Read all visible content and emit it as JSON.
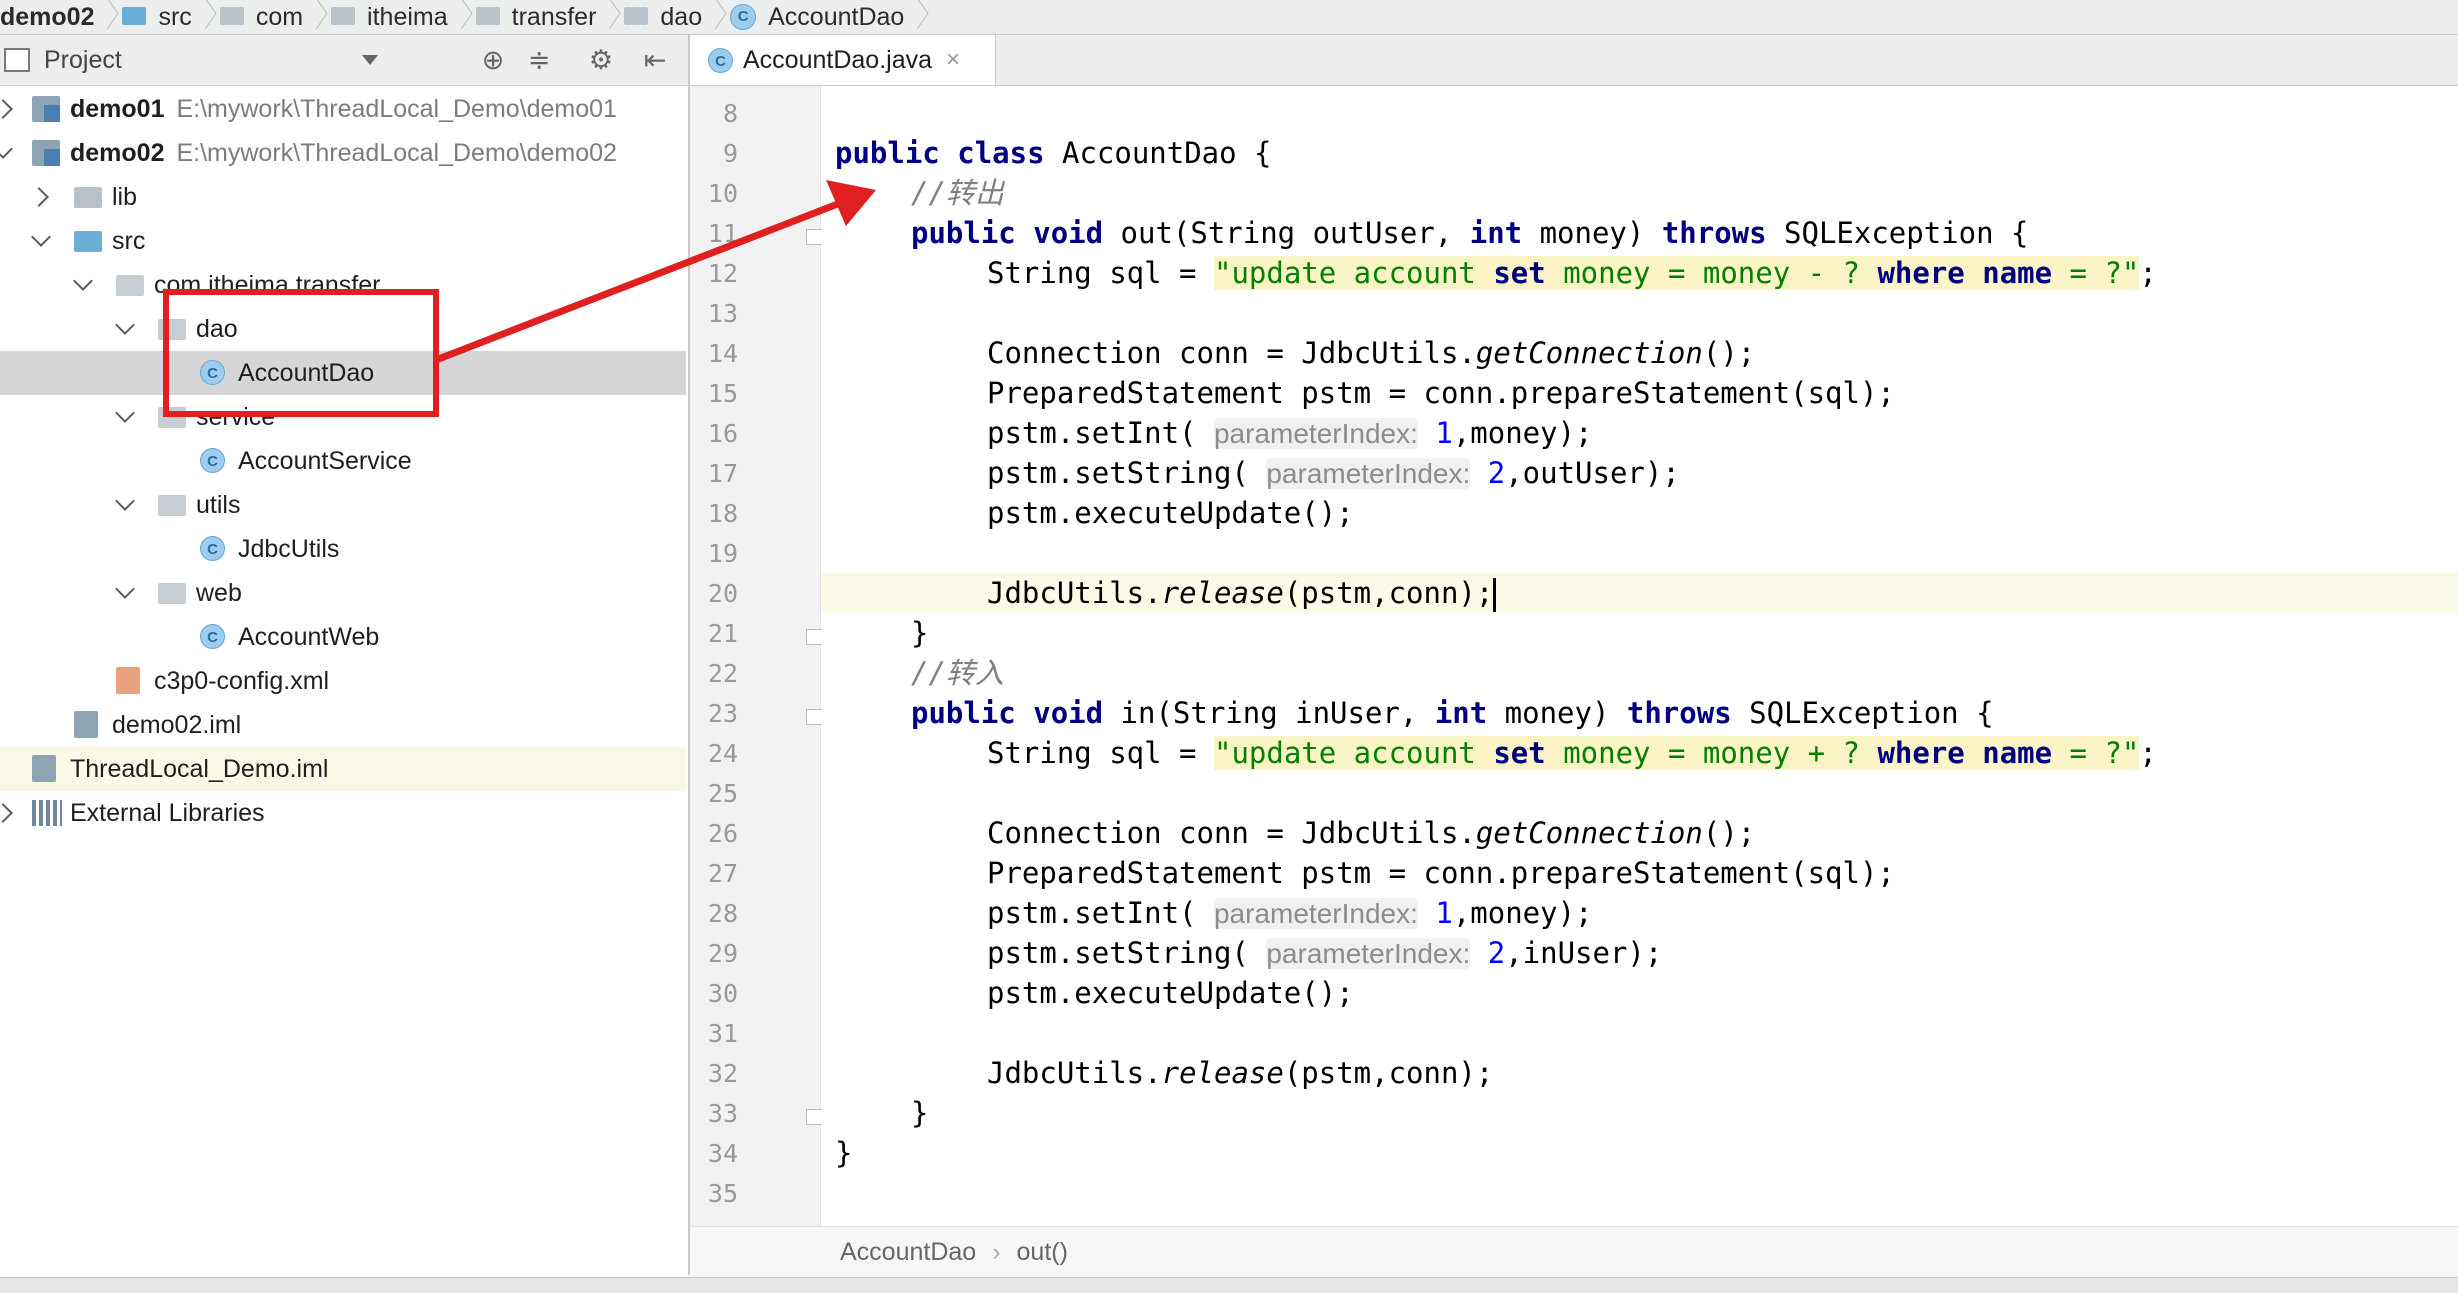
{
  "breadcrumbs": [
    "demo02",
    "src",
    "com",
    "itheima",
    "transfer",
    "dao",
    "AccountDao"
  ],
  "project_panel": {
    "title": "Project",
    "tree": [
      {
        "label": "demo01",
        "path": "E:\\mywork\\ThreadLocal_Demo\\demo01"
      },
      {
        "label": "demo02",
        "path": "E:\\mywork\\ThreadLocal_Demo\\demo02"
      },
      {
        "label": "lib"
      },
      {
        "label": "src"
      },
      {
        "label": "com.itheima.transfer"
      },
      {
        "label": "dao"
      },
      {
        "label": "AccountDao"
      },
      {
        "label": "service"
      },
      {
        "label": "AccountService"
      },
      {
        "label": "utils"
      },
      {
        "label": "JdbcUtils"
      },
      {
        "label": "web"
      },
      {
        "label": "AccountWeb"
      },
      {
        "label": "c3p0-config.xml"
      },
      {
        "label": "demo02.iml"
      },
      {
        "label": "ThreadLocal_Demo.iml"
      },
      {
        "label": "External Libraries"
      }
    ]
  },
  "editor": {
    "tab_label": "AccountDao.java",
    "tab_close": "×",
    "line_numbers": [
      "8",
      "9",
      "10",
      "11",
      "12",
      "13",
      "14",
      "15",
      "16",
      "17",
      "18",
      "19",
      "20",
      "21",
      "22",
      "23",
      "24",
      "25",
      "26",
      "27",
      "28",
      "29",
      "30",
      "31",
      "32",
      "33",
      "34",
      "35"
    ],
    "current_line": "20",
    "code": {
      "class_decl": "public class AccountDao {",
      "comment_out": "//转出",
      "out_sig": "public void out(String outUser, int money) throws SQLException {",
      "out_sql_prefix": "String sql = ",
      "out_sql": "\"update account set money = money - ? where name = ?\"",
      "conn": "Connection conn = JdbcUtils.getConnection();",
      "pstm": "PreparedStatement pstm = conn.prepareStatement(sql);",
      "setint_prefix": "pstm.setInt( ",
      "hint_1": "parameterIndex:",
      "setint_arg1": "1",
      "setint_rest": ",money);",
      "setstring_prefix": "pstm.setString( ",
      "hint_2": "parameterIndex:",
      "setstring_arg1": "2",
      "out_setstring_rest": ",outUser);",
      "execute": "pstm.executeUpdate();",
      "release": "JdbcUtils.release(pstm,conn);",
      "close_brace": "}",
      "comment_in": "//转入",
      "in_sig": "public void in(String inUser, int money) throws SQLException {",
      "in_sql": "\"update account set money = money + ? where name = ?\"",
      "in_setstring_rest": ",inUser);",
      "semicolon": ";"
    },
    "breadcrumb": [
      "AccountDao",
      "out()"
    ],
    "breadcrumb_sep": "›"
  },
  "colors": {
    "annotation": "#e02020",
    "keyword": "#000080",
    "comment": "#808080",
    "string": "#008000",
    "number": "#0000ff"
  }
}
